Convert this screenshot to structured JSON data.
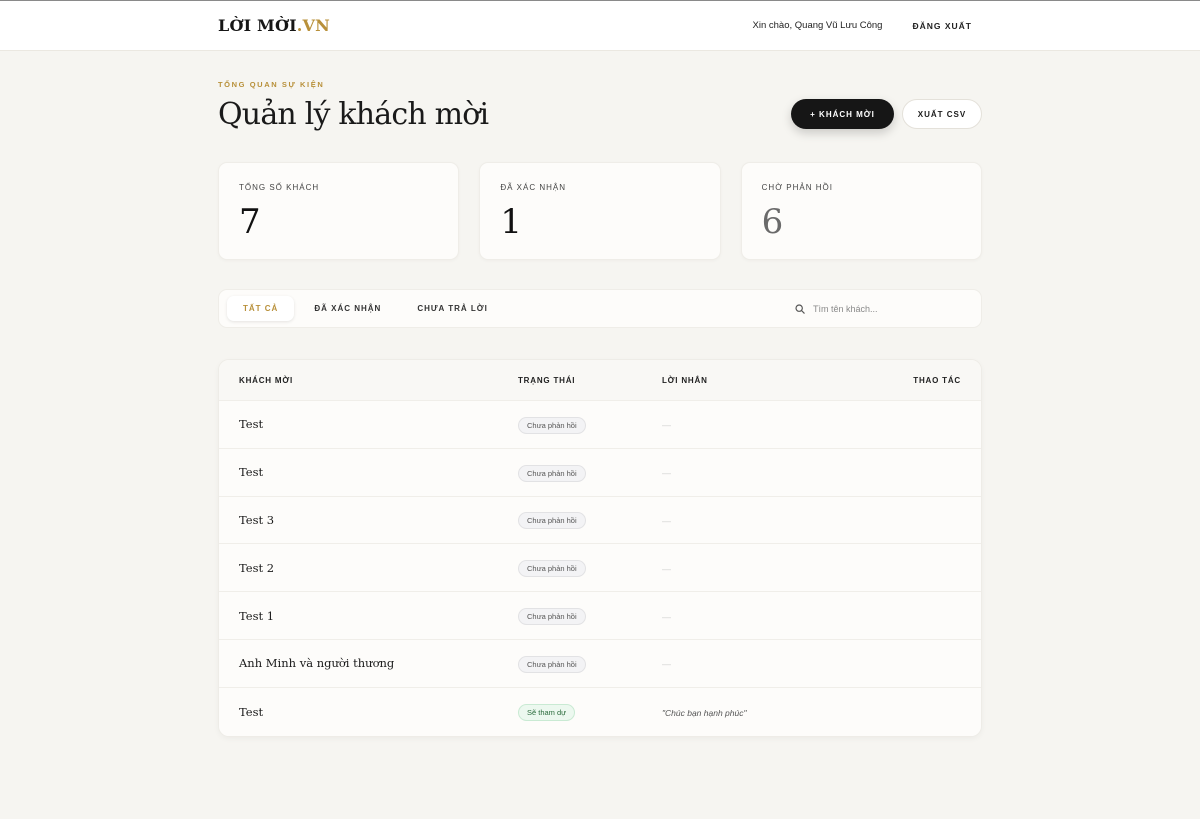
{
  "brand": {
    "name": "LỜI MỜI",
    "suffix": ".VN",
    "accent_color": "#b8903a"
  },
  "header": {
    "greeting": "Xin chào, Quang Vũ Lưu Công",
    "logout_label": "ĐĂNG XUẤT"
  },
  "page": {
    "eyebrow": "TỔNG QUAN SỰ KIỆN",
    "title": "Quản lý khách mời"
  },
  "actions": {
    "add_guest_label": "+ KHÁCH MỜI",
    "export_label": "XUẤT CSV"
  },
  "stats": [
    {
      "label": "TỔNG SỐ KHÁCH",
      "value": "7"
    },
    {
      "label": "ĐÃ XÁC NHẬN",
      "value": "1"
    },
    {
      "label": "CHỜ PHẢN HỒI",
      "value": "6"
    }
  ],
  "filters": {
    "tabs": [
      "TẤT CẢ",
      "ĐÃ XÁC NHẬN",
      "CHƯA TRẢ LỜI"
    ],
    "active_tab": "TẤT CẢ",
    "search_placeholder": "Tìm tên khách..."
  },
  "table": {
    "headers": {
      "name": "KHÁCH MỜI",
      "status": "TRẠNG THÁI",
      "message": "LỜI NHẮN",
      "actions": "THAO TÁC"
    },
    "rows": [
      {
        "name": "Test",
        "status": "Chưa phản hồi",
        "message": "—"
      },
      {
        "name": "Test",
        "status": "Chưa phản hồi",
        "message": "—"
      },
      {
        "name": "Test 3",
        "status": "Chưa phản hồi",
        "message": "—"
      },
      {
        "name": "Test 2",
        "status": "Chưa phản hồi",
        "message": "—"
      },
      {
        "name": "Test 1",
        "status": "Chưa phản hồi",
        "message": "—"
      },
      {
        "name": "Anh Minh và người thương",
        "status": "Chưa phản hồi",
        "message": "—"
      },
      {
        "name": "Test",
        "status": "Sẽ tham dự",
        "message": "\"Chúc bạn hạnh phúc\""
      }
    ]
  }
}
